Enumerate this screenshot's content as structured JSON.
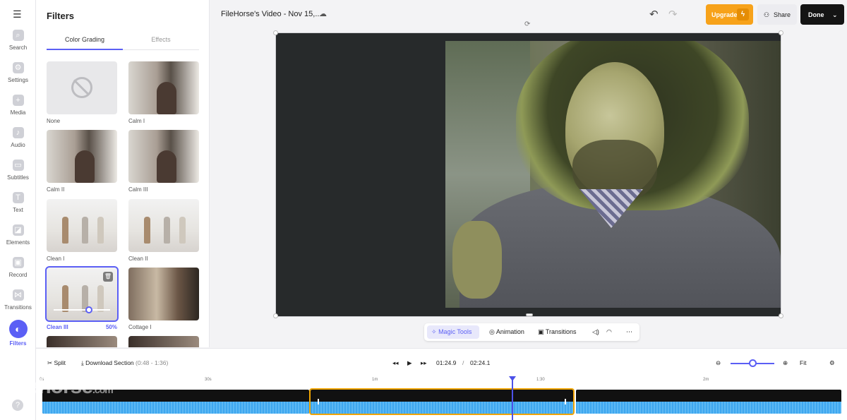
{
  "rail": {
    "items": [
      {
        "label": "Search",
        "icon": "search-icon"
      },
      {
        "label": "Settings",
        "icon": "gear-icon"
      },
      {
        "label": "Media",
        "icon": "plus-icon"
      },
      {
        "label": "Audio",
        "icon": "music-note-icon"
      },
      {
        "label": "Subtitles",
        "icon": "subtitles-icon"
      },
      {
        "label": "Text",
        "icon": "text-icon"
      },
      {
        "label": "Elements",
        "icon": "elements-icon"
      },
      {
        "label": "Record",
        "icon": "record-icon"
      },
      {
        "label": "Transitions",
        "icon": "transitions-icon"
      },
      {
        "label": "Filters",
        "icon": "filters-icon"
      }
    ],
    "active": "Filters"
  },
  "panel": {
    "title": "Filters",
    "tabs": [
      "Color Grading",
      "Effects"
    ],
    "active_tab": "Color Grading",
    "filters": [
      {
        "label": "None"
      },
      {
        "label": "Calm I"
      },
      {
        "label": "Calm II"
      },
      {
        "label": "Calm III"
      },
      {
        "label": "Clean I"
      },
      {
        "label": "Clean II"
      },
      {
        "label": "Clean III",
        "selected": true,
        "intensity": "50%"
      },
      {
        "label": "Cottage I"
      }
    ]
  },
  "topbar": {
    "project_title": "FileHorse's Video - Nov 15,...",
    "upgrade_label": "Upgrade",
    "share_label": "Share",
    "done_label": "Done",
    "accent": "#f7a21a"
  },
  "video_toolbar": {
    "magic_tools": "Magic Tools",
    "animation": "Animation",
    "transitions": "Transitions"
  },
  "timeline": {
    "split_label": "Split",
    "download_label": "Download Section",
    "download_range": "(0:48 - 1:36)",
    "current_time": "01:24.9",
    "separator": "/",
    "total_time": "02:24.1",
    "fit_label": "Fit",
    "ruler_ticks": [
      "0s",
      "30s",
      "1m",
      "1:30",
      "2m"
    ],
    "zoom_level": 0.5
  },
  "watermark": {
    "text": "filehorse",
    "suffix": ".com"
  },
  "colors": {
    "accent": "#5b5ff5",
    "selection": "#f0a400",
    "waveform": "#3ea7ef"
  }
}
